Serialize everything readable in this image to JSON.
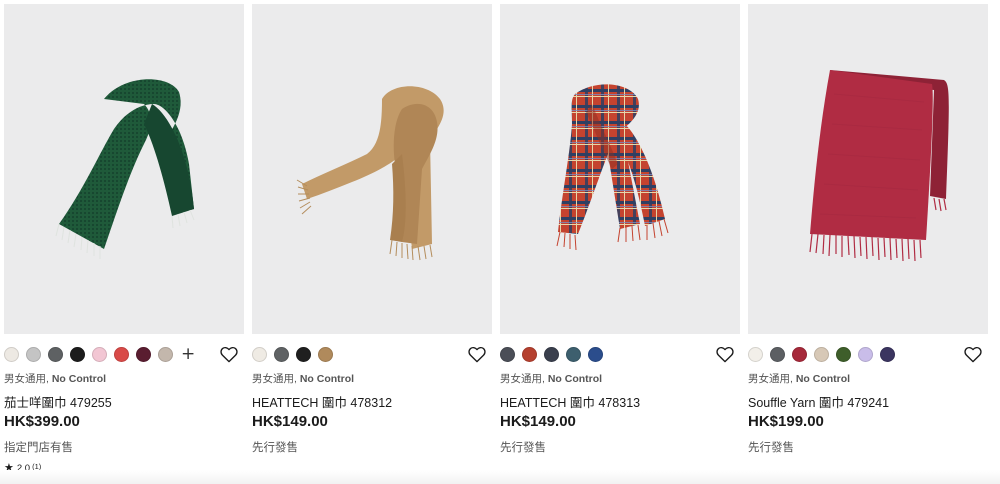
{
  "products": [
    {
      "image_name": "green-checked-scarf-image",
      "colors": [
        "#ede9e3",
        "#c4c4c4",
        "#5e6163",
        "#1c1c1c",
        "#f2c6d3",
        "#d94a48",
        "#5a1d30",
        "#c3b7ac"
      ],
      "more_icon": "plus-icon",
      "gender_label": "男女通用,",
      "size_label": "No Control",
      "name": "茄士咩圍巾 479255",
      "price": "HK$399.00",
      "availability": "指定門店有售",
      "rating": {
        "score": "2.0",
        "count": "(1)"
      },
      "scarf_color": "#1f5a3a"
    },
    {
      "image_name": "camel-heattech-scarf-image",
      "colors": [
        "#efebe4",
        "#5f6264",
        "#1f1f1f",
        "#b08a5c"
      ],
      "gender_label": "男女通用,",
      "size_label": "No Control",
      "name": "HEATTECH 圍巾 478312",
      "price": "HK$149.00",
      "availability": "先行發售",
      "scarf_color": "#c29a68"
    },
    {
      "image_name": "red-plaid-heattech-scarf-image",
      "colors": [
        "#4b4e57",
        "#b5402f",
        "#3a3f4d",
        "#3d5f6e",
        "#2b4d8c"
      ],
      "gender_label": "男女通用,",
      "size_label": "No Control",
      "name": "HEATTECH 圍巾 478313",
      "price": "HK$149.00",
      "availability": "先行發售",
      "scarf_color": "#c4432f"
    },
    {
      "image_name": "red-souffle-yarn-scarf-image",
      "colors": [
        "#f2efe9",
        "#5c5f63",
        "#a6293a",
        "#d7c8b6",
        "#3e5e2a",
        "#c9bde9",
        "#3b3560"
      ],
      "gender_label": "男女通用,",
      "size_label": "No Control",
      "name": "Souffle Yarn 圍巾 479241",
      "price": "HK$199.00",
      "availability": "先行發售",
      "scarf_color": "#b02c43"
    }
  ]
}
